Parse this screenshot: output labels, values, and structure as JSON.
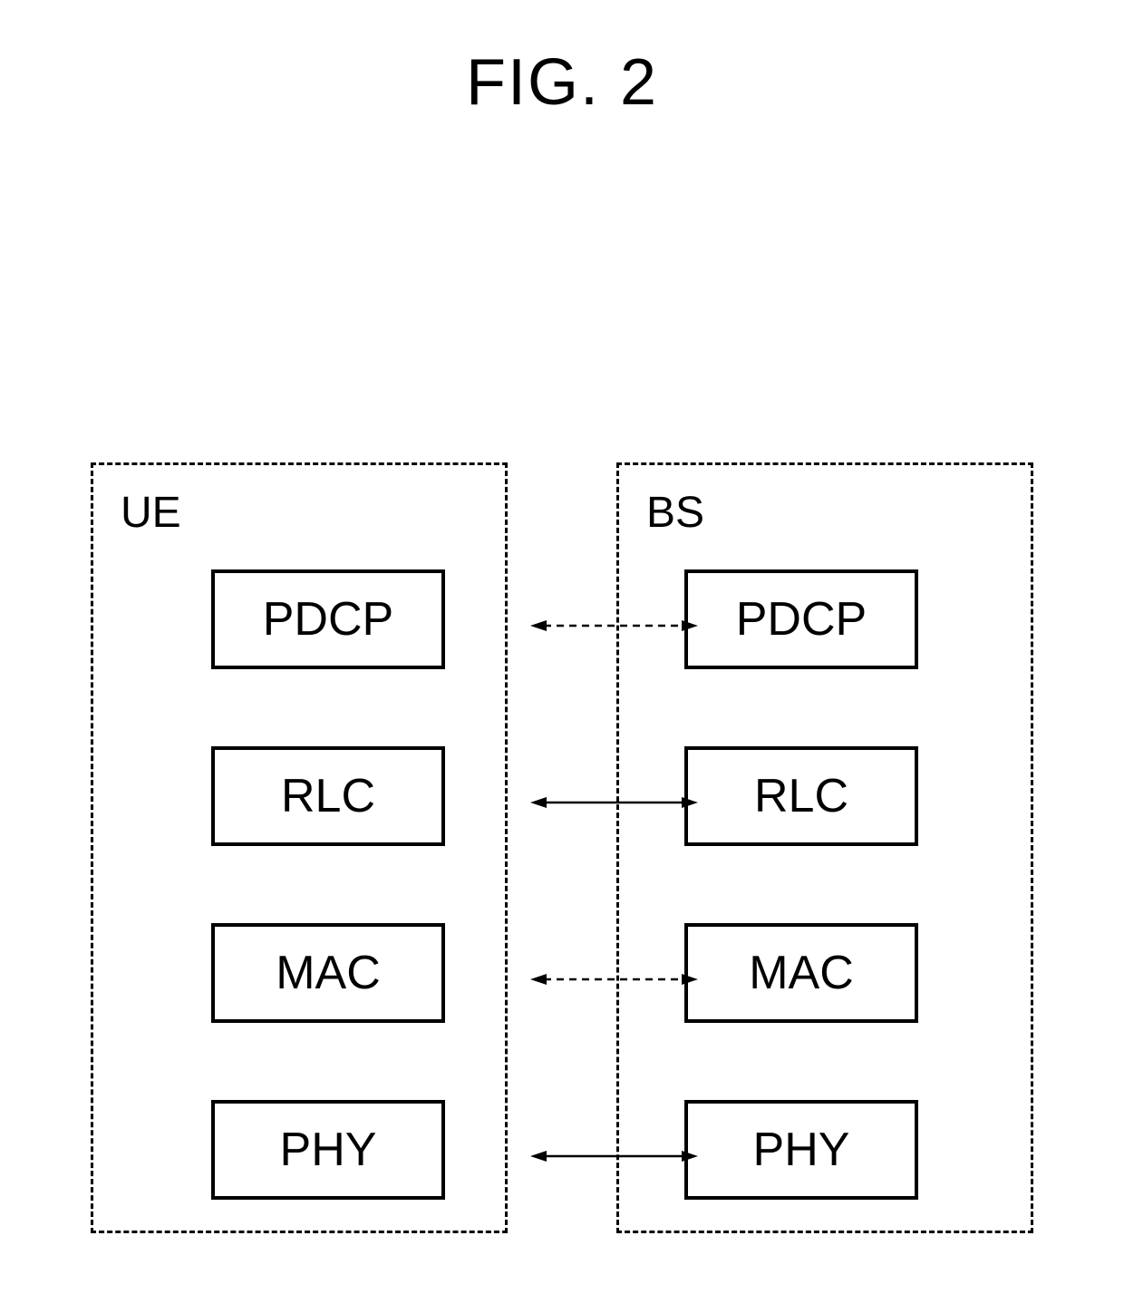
{
  "title": "FIG. 2",
  "left": {
    "label": "UE",
    "layers": [
      "PDCP",
      "RLC",
      "MAC",
      "PHY"
    ]
  },
  "right": {
    "label": "BS",
    "layers": [
      "PDCP",
      "RLC",
      "MAC",
      "PHY"
    ]
  },
  "connections": [
    {
      "style": "dashed"
    },
    {
      "style": "solid"
    },
    {
      "style": "dashed"
    },
    {
      "style": "solid"
    }
  ]
}
